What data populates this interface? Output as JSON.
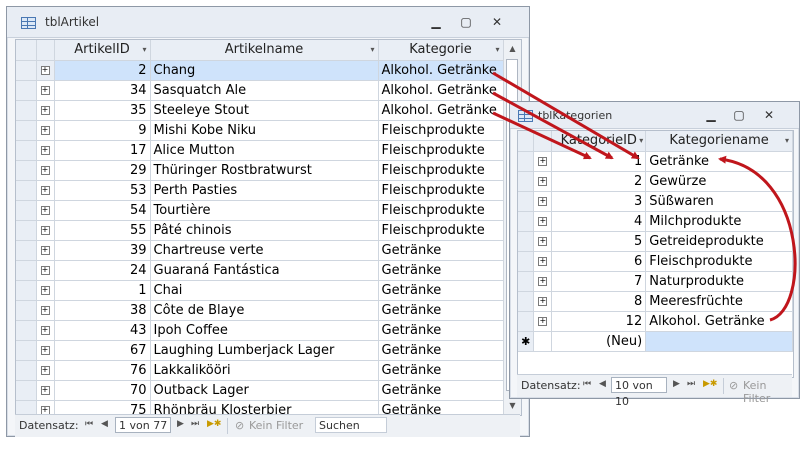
{
  "articles_window": {
    "title": "tblArtikel",
    "columns": [
      "ArtikelID",
      "Artikelname",
      "Kategorie"
    ],
    "rows": [
      {
        "id": "2",
        "name": "Chang",
        "category": "Alkohol. Getränke"
      },
      {
        "id": "34",
        "name": "Sasquatch Ale",
        "category": "Alkohol. Getränke"
      },
      {
        "id": "35",
        "name": "Steeleye Stout",
        "category": "Alkohol. Getränke"
      },
      {
        "id": "9",
        "name": "Mishi Kobe Niku",
        "category": "Fleischprodukte"
      },
      {
        "id": "17",
        "name": "Alice Mutton",
        "category": "Fleischprodukte"
      },
      {
        "id": "29",
        "name": "Thüringer Rostbratwurst",
        "category": "Fleischprodukte"
      },
      {
        "id": "53",
        "name": "Perth Pasties",
        "category": "Fleischprodukte"
      },
      {
        "id": "54",
        "name": "Tourtière",
        "category": "Fleischprodukte"
      },
      {
        "id": "55",
        "name": "Pâté chinois",
        "category": "Fleischprodukte"
      },
      {
        "id": "39",
        "name": "Chartreuse verte",
        "category": "Getränke"
      },
      {
        "id": "24",
        "name": "Guaraná Fantástica",
        "category": "Getränke"
      },
      {
        "id": "1",
        "name": "Chai",
        "category": "Getränke"
      },
      {
        "id": "38",
        "name": "Côte de Blaye",
        "category": "Getränke"
      },
      {
        "id": "43",
        "name": "Ipoh Coffee",
        "category": "Getränke"
      },
      {
        "id": "67",
        "name": "Laughing Lumberjack Lager",
        "category": "Getränke"
      },
      {
        "id": "76",
        "name": "Lakkalikööri",
        "category": "Getränke"
      },
      {
        "id": "70",
        "name": "Outback Lager",
        "category": "Getränke"
      },
      {
        "id": "75",
        "name": "Rhönbräu Klosterbier",
        "category": "Getränke"
      }
    ],
    "nav": {
      "label": "Datensatz:",
      "position": "1 von 77",
      "filter": "Kein Filter",
      "search": "Suchen"
    }
  },
  "categories_window": {
    "title": "tblKategorien",
    "columns": [
      "KategorieID",
      "Kategoriename"
    ],
    "rows": [
      {
        "id": "1",
        "name": "Getränke"
      },
      {
        "id": "2",
        "name": "Gewürze"
      },
      {
        "id": "3",
        "name": "Süßwaren"
      },
      {
        "id": "4",
        "name": "Milchprodukte"
      },
      {
        "id": "5",
        "name": "Getreideprodukte"
      },
      {
        "id": "6",
        "name": "Fleischprodukte"
      },
      {
        "id": "7",
        "name": "Naturprodukte"
      },
      {
        "id": "8",
        "name": "Meeresfrüchte"
      },
      {
        "id": "12",
        "name": "Alkohol. Getränke"
      }
    ],
    "new_row": "(Neu)",
    "new_marker": "✱",
    "nav": {
      "label": "Datensatz:",
      "position": "10 von 10",
      "filter": "Kein Filter"
    }
  },
  "icons": {
    "first": "first-record-icon",
    "prev": "prev-record-icon",
    "next": "next-record-icon",
    "last": "last-record-icon",
    "new": "new-record-icon",
    "filter": "filter-icon"
  },
  "colors": {
    "arrow": "#c0161c",
    "selected_row": "#cfe3fb"
  }
}
